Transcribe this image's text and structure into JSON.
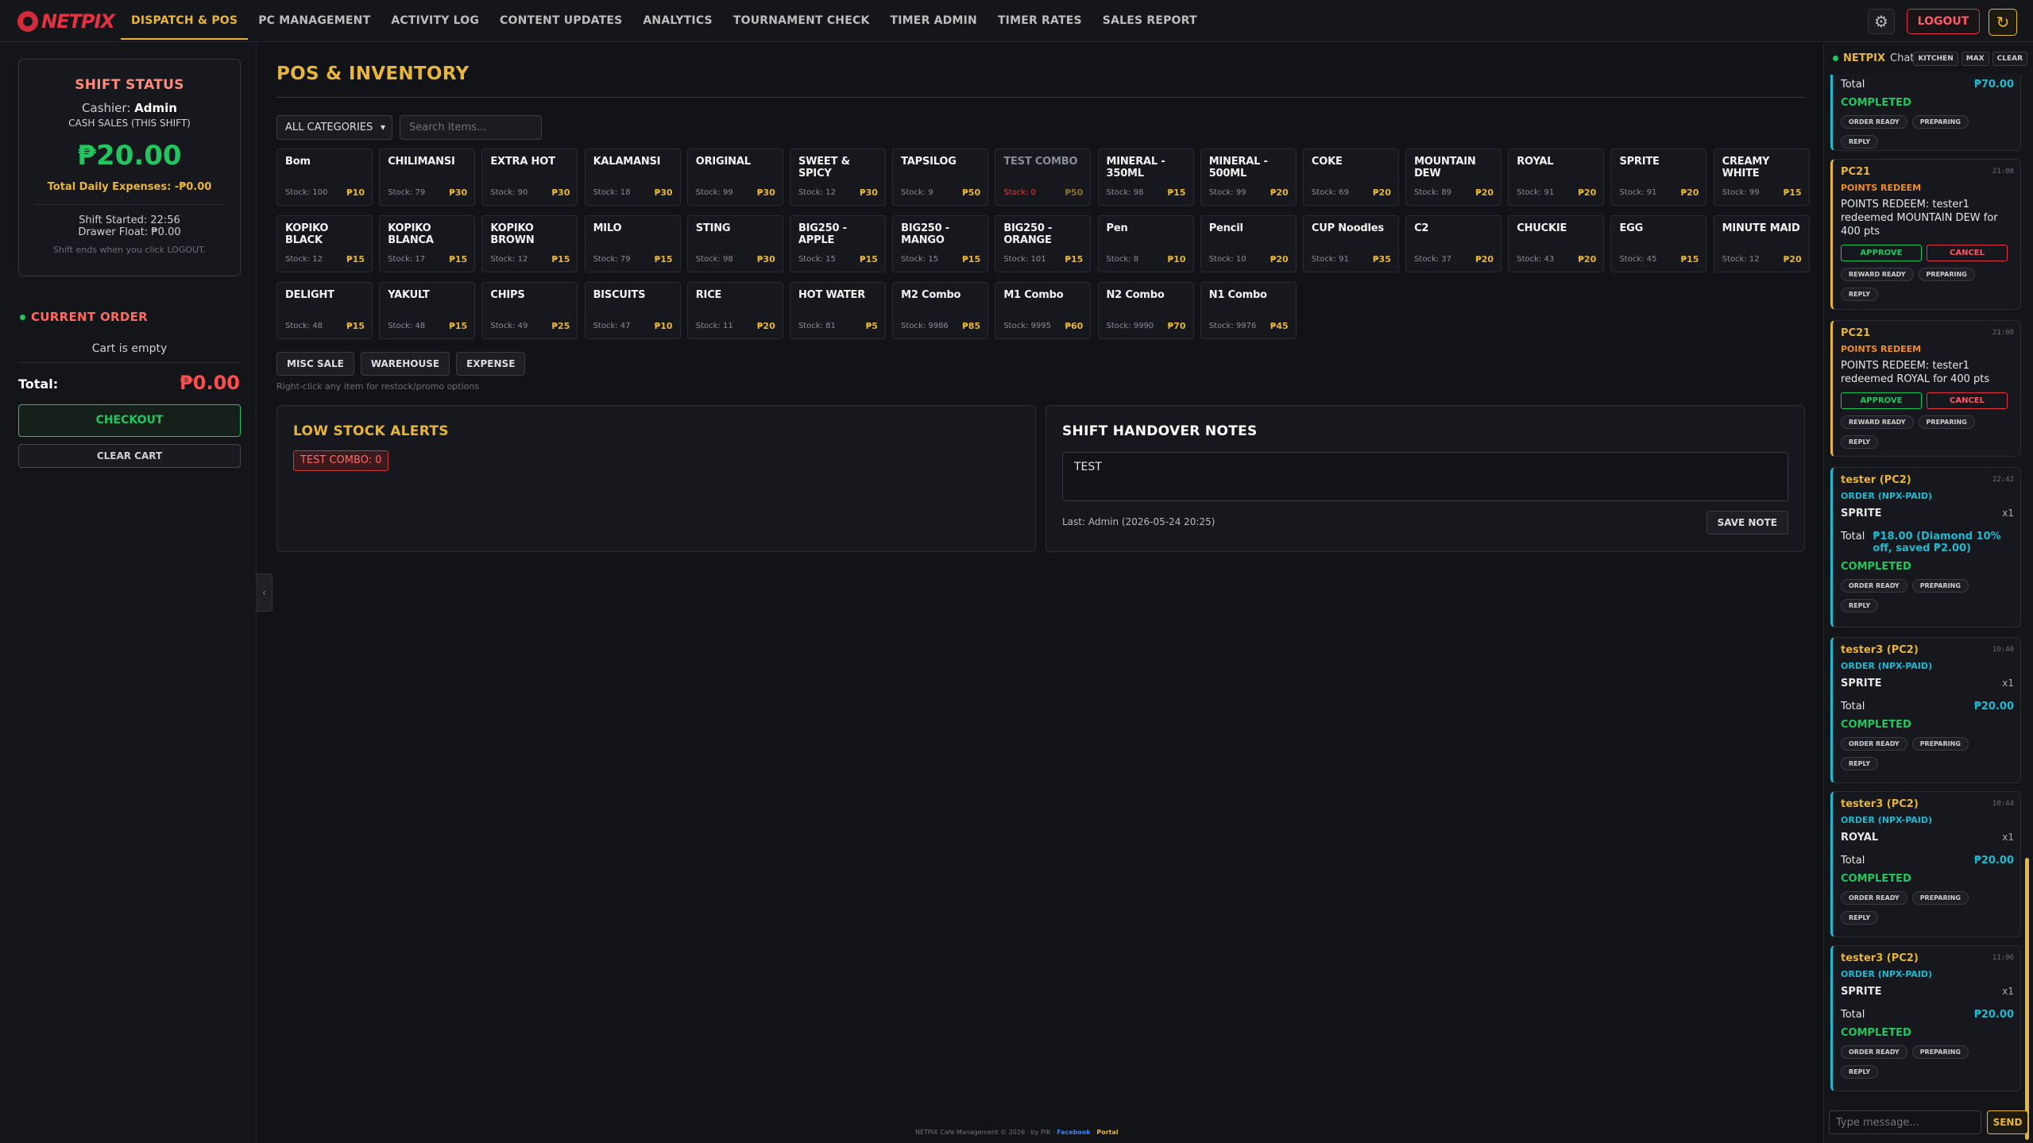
{
  "brand": {
    "name": "NETPIX"
  },
  "nav": {
    "tabs": [
      {
        "label": "DISPATCH & POS",
        "active": true
      },
      {
        "label": "PC MANAGEMENT"
      },
      {
        "label": "ACTIVITY LOG"
      },
      {
        "label": "CONTENT UPDATES"
      },
      {
        "label": "ANALYTICS"
      },
      {
        "label": "TOURNAMENT CHECK"
      },
      {
        "label": "TIMER ADMIN"
      },
      {
        "label": "TIMER RATES"
      },
      {
        "label": "SALES REPORT"
      }
    ],
    "gear_icon": "⚙",
    "logout_label": "LOGOUT",
    "refresh_icon": "↻"
  },
  "shift": {
    "title": "SHIFT STATUS",
    "cashier_label": "Cashier:",
    "cashier_name": "Admin",
    "cash_sales_label": "CASH SALES (THIS SHIFT)",
    "cash_sales_value": "₱20.00",
    "expenses_text": "Total Daily Expenses: -₱0.00",
    "started_text": "Shift Started: 22:56",
    "drawer_text": "Drawer Float: ₱0.00",
    "note": "Shift ends when you click LOGOUT."
  },
  "order": {
    "title": "CURRENT ORDER",
    "empty_text": "Cart is empty",
    "total_label": "Total:",
    "total_value": "₱0.00",
    "checkout_label": "CHECKOUT",
    "clear_label": "CLEAR CART"
  },
  "collapse_icon": "‹",
  "pos": {
    "title": "POS & INVENTORY",
    "category_select": "ALL CATEGORIES",
    "search_placeholder": "Search items...",
    "items": [
      {
        "name": "Bom",
        "stock": "Stock: 100",
        "price": "₱10"
      },
      {
        "name": "CHILIMANSI",
        "stock": "Stock: 79",
        "price": "₱30"
      },
      {
        "name": "EXTRA HOT",
        "stock": "Stock: 90",
        "price": "₱30"
      },
      {
        "name": "KALAMANSI",
        "stock": "Stock: 18",
        "price": "₱30"
      },
      {
        "name": "ORIGINAL",
        "stock": "Stock: 99",
        "price": "₱30"
      },
      {
        "name": "SWEET & SPICY",
        "stock": "Stock: 12",
        "price": "₱30"
      },
      {
        "name": "TAPSILOG",
        "stock": "Stock: 9",
        "price": "₱50"
      },
      {
        "name": "TEST COMBO",
        "stock": "Stock: 0",
        "price": "₱50",
        "dim": true
      },
      {
        "name": "MINERAL - 350ML",
        "stock": "Stock: 98",
        "price": "₱15"
      },
      {
        "name": "MINERAL - 500ML",
        "stock": "Stock: 99",
        "price": "₱20"
      },
      {
        "name": "COKE",
        "stock": "Stock: 69",
        "price": "₱20"
      },
      {
        "name": "MOUNTAIN DEW",
        "stock": "Stock: 89",
        "price": "₱20"
      },
      {
        "name": "ROYAL",
        "stock": "Stock: 91",
        "price": "₱20"
      },
      {
        "name": "SPRITE",
        "stock": "Stock: 91",
        "price": "₱20"
      },
      {
        "name": "CREAMY WHITE",
        "stock": "Stock: 99",
        "price": "₱15"
      },
      {
        "name": "KOPIKO BLACK",
        "stock": "Stock: 12",
        "price": "₱15"
      },
      {
        "name": "KOPIKO BLANCA",
        "stock": "Stock: 17",
        "price": "₱15"
      },
      {
        "name": "KOPIKO BROWN",
        "stock": "Stock: 12",
        "price": "₱15"
      },
      {
        "name": "MILO",
        "stock": "Stock: 79",
        "price": "₱15"
      },
      {
        "name": "STING",
        "stock": "Stock: 98",
        "price": "₱30"
      },
      {
        "name": "BIG250 - APPLE",
        "stock": "Stock: 15",
        "price": "₱15"
      },
      {
        "name": "BIG250 - MANGO",
        "stock": "Stock: 15",
        "price": "₱15"
      },
      {
        "name": "BIG250 - ORANGE",
        "stock": "Stock: 101",
        "price": "₱15"
      },
      {
        "name": "Pen",
        "stock": "Stock: 8",
        "price": "₱10"
      },
      {
        "name": "Pencil",
        "stock": "Stock: 10",
        "price": "₱20"
      },
      {
        "name": "CUP Noodles",
        "stock": "Stock: 91",
        "price": "₱35"
      },
      {
        "name": "C2",
        "stock": "Stock: 37",
        "price": "₱20"
      },
      {
        "name": "CHUCKIE",
        "stock": "Stock: 43",
        "price": "₱20"
      },
      {
        "name": "EGG",
        "stock": "Stock: 45",
        "price": "₱15"
      },
      {
        "name": "MINUTE MAID",
        "stock": "Stock: 12",
        "price": "₱20"
      },
      {
        "name": "DELIGHT",
        "stock": "Stock: 48",
        "price": "₱15"
      },
      {
        "name": "YAKULT",
        "stock": "Stock: 48",
        "price": "₱15"
      },
      {
        "name": "CHIPS",
        "stock": "Stock: 49",
        "price": "₱25"
      },
      {
        "name": "BISCUITS",
        "stock": "Stock: 47",
        "price": "₱10"
      },
      {
        "name": "RICE",
        "stock": "Stock: 11",
        "price": "₱20"
      },
      {
        "name": "HOT WATER",
        "stock": "Stock: 81",
        "price": "₱5"
      },
      {
        "name": "M2 Combo",
        "stock": "Stock: 9986",
        "price": "₱85"
      },
      {
        "name": "M1 Combo",
        "stock": "Stock: 9995",
        "price": "₱60"
      },
      {
        "name": "N2 Combo",
        "stock": "Stock: 9990",
        "price": "₱70"
      },
      {
        "name": "N1 Combo",
        "stock": "Stock: 9976",
        "price": "₱45"
      }
    ],
    "actions": [
      "MISC SALE",
      "WAREHOUSE",
      "EXPENSE"
    ],
    "hint": "Right-click any item for restock/promo options"
  },
  "low_stock": {
    "title": "LOW STOCK ALERTS",
    "alerts": [
      "TEST COMBO: 0"
    ]
  },
  "notes": {
    "title": "SHIFT HANDOVER NOTES",
    "value": "TEST",
    "last": "Last: Admin (2026-05-24 20:25)",
    "save_label": "SAVE NOTE"
  },
  "footer": {
    "text": "NETPIX Cafe Management © 2026 · by PIK · ",
    "facebook": "Facebook",
    "portal": "Portal"
  },
  "chat": {
    "brand": "NETPIX",
    "title": "Chat",
    "buttons": [
      "KITCHEN",
      "MAX",
      "CLEAR"
    ],
    "input_placeholder": "Type message...",
    "send_label": "SEND",
    "chips": {
      "order_ready": "ORDER READY",
      "preparing": "PREPARING",
      "reply": "REPLY",
      "reward_ready": "REWARD READY"
    },
    "approve_label": "APPROVE",
    "cancel_label": "CANCEL",
    "messages": [
      {
        "total_label": "Total",
        "total": "₱70.00",
        "status": "COMPLETED"
      },
      {
        "name": "PC21",
        "time": "21:08",
        "tag": "POINTS REDEEM",
        "body": "POINTS REDEEM: tester1 redeemed MOUNTAIN DEW for 400 pts"
      },
      {
        "name": "PC21",
        "time": "21:08",
        "tag": "POINTS REDEEM",
        "body": "POINTS REDEEM: tester1 redeemed ROYAL for 400 pts"
      },
      {
        "name": "tester (PC2)",
        "time": "22:42",
        "tag": "ORDER (NPX-PAID)",
        "item": "SPRITE",
        "qty": "x1",
        "total_label": "Total",
        "total": "₱18.00 (Diamond 10% off, saved ₱2.00)",
        "status": "COMPLETED"
      },
      {
        "name": "tester3 (PC2)",
        "time": "10:40",
        "tag": "ORDER (NPX-PAID)",
        "item": "SPRITE",
        "qty": "x1",
        "total_label": "Total",
        "total": "₱20.00",
        "status": "COMPLETED"
      },
      {
        "name": "tester3 (PC2)",
        "time": "10:44",
        "tag": "ORDER (NPX-PAID)",
        "item": "ROYAL",
        "qty": "x1",
        "total_label": "Total",
        "total": "₱20.00",
        "status": "COMPLETED"
      },
      {
        "name": "tester3 (PC2)",
        "time": "11:06",
        "tag": "ORDER (NPX-PAID)",
        "item": "SPRITE",
        "qty": "x1",
        "total_label": "Total",
        "total": "₱20.00",
        "status": "COMPLETED"
      }
    ]
  }
}
